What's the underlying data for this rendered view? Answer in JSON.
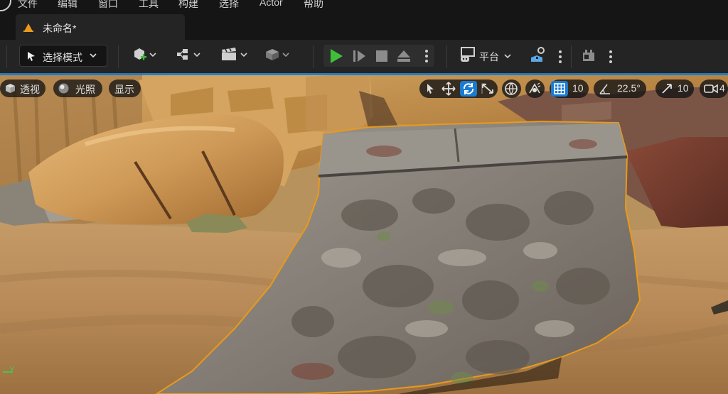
{
  "menu": {
    "items": [
      "文件",
      "编辑",
      "窗口",
      "工具",
      "构建",
      "选择",
      "Actor",
      "帮助"
    ]
  },
  "tab": {
    "title": "未命名*"
  },
  "toolbar": {
    "mode_label": "选择模式",
    "platform_label": "平台",
    "icons": [
      "mode-select-icon",
      "add-actor-icon",
      "blueprint-icon",
      "cinematics-icon",
      "content-icon",
      "play-icon",
      "step-icon",
      "stop-icon",
      "eject-icon",
      "platform-icon",
      "settings-icon",
      "source-control-icon"
    ]
  },
  "viewport": {
    "perspective_label": "透视",
    "lighting_label": "光照",
    "show_label": "显示",
    "grid_snap_value": "10",
    "rotation_snap_value": "22.5°",
    "scale_snap_value": "10",
    "camera_speed_value": "4",
    "axis_label": "Y"
  },
  "colors": {
    "accent": "#0a78d2",
    "selection_outline": "#e89a1c",
    "play_green": "#3fbf3a"
  }
}
